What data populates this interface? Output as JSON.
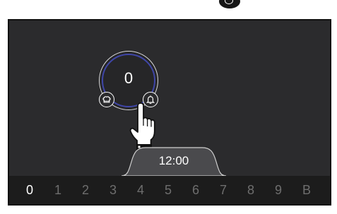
{
  "dial": {
    "value": "0"
  },
  "time": {
    "label": "12:00"
  },
  "digits": [
    "0",
    "1",
    "2",
    "3",
    "4",
    "5",
    "6",
    "7",
    "8",
    "9",
    "B"
  ],
  "active_digit": "0",
  "colors": {
    "panel": "#2b2b2d",
    "ring_accent": "#3f46a8",
    "digit_active": "#ffffff",
    "digit_inactive": "#6e6e6e"
  },
  "icons": [
    "chef-hat-icon",
    "bell-icon",
    "pointing-hand-icon",
    "top-button-icon"
  ]
}
